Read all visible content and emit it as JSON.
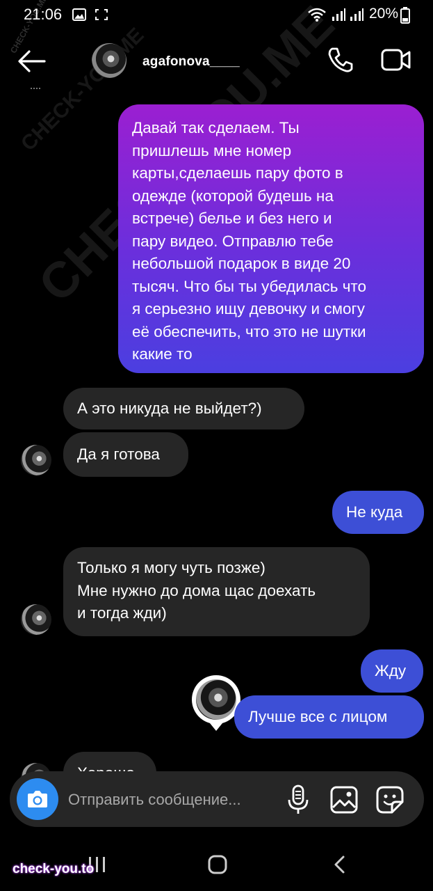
{
  "status_bar": {
    "time": "21:06",
    "battery": "20%"
  },
  "header": {
    "username": "agafonova____"
  },
  "messages": [
    {
      "side": "sent",
      "style": "gradient",
      "text": "Давай так сделаем. Ты\nпришлешь мне номер\nкарты,сделаешь пару фото в\nодежде (которой будешь на\nвстрече) белье и без него и\nпару видео. Отправлю тебе\nнебольшой подарок в виде 20\nтысяч. Что бы ты убедилась что\nя серьезно ищу девочку и смогу\nеё обеспечить, что это не шутки\nкакие то"
    },
    {
      "side": "received",
      "text": "А это никуда не выйдет?)"
    },
    {
      "side": "received",
      "text": "Да я готова"
    },
    {
      "side": "sent",
      "text": "Не куда"
    },
    {
      "side": "received",
      "text": "Только я могу чуть позже)\nМне нужно до дома щас доехать\nи тогда жди)"
    },
    {
      "side": "sent",
      "text": "Жду"
    },
    {
      "side": "sent",
      "text": "Лучше все с лицом"
    },
    {
      "side": "received",
      "text": "Хорошо"
    }
  ],
  "composer": {
    "placeholder": "Отправить сообщение..."
  },
  "watermarks": {
    "diagonal_large": "CHECK-YOU.ME",
    "diagonal_small": "CHECK-YOU.ME",
    "footer": "check-you.to"
  },
  "colors": {
    "received_bubble": "#262626",
    "sent_bubble": "#3d4fd6",
    "gradient_top": "#9b1fd1",
    "gradient_bottom": "#4b3fe0",
    "camera_button": "#2d8cf0"
  }
}
